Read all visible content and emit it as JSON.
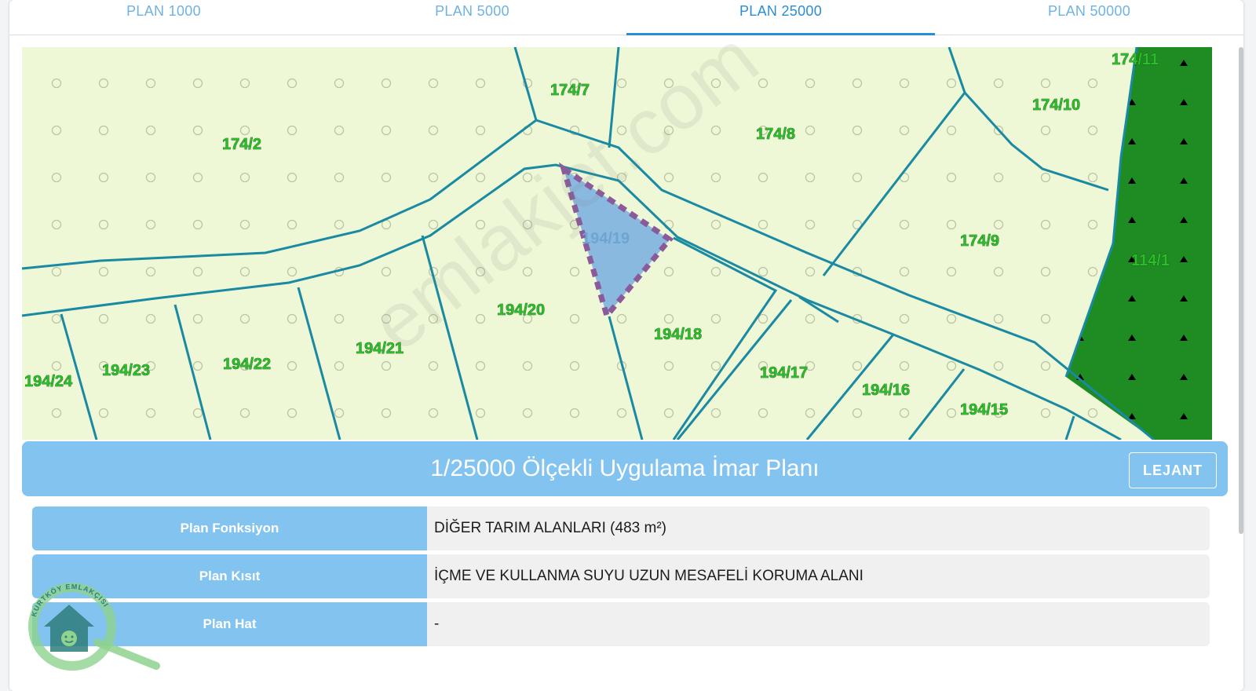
{
  "tabs": [
    {
      "label": "PLAN 1000",
      "active": false
    },
    {
      "label": "PLAN 5000",
      "active": false
    },
    {
      "label": "PLAN 25000",
      "active": true
    },
    {
      "label": "PLAN 50000",
      "active": false
    }
  ],
  "map": {
    "parcels": {
      "p174_2": "174/2",
      "p174_7": "174/7",
      "p174_8": "174/8",
      "p174_9": "174/9",
      "p174_10": "174/10",
      "p174_11": "174/11",
      "p114_1": "114/1",
      "p194_19": "194/19",
      "p194_20": "194/20",
      "p194_18": "194/18",
      "p194_17": "194/17",
      "p194_16": "194/16",
      "p194_15": "194/15",
      "p194_21": "194/21",
      "p194_22": "194/22",
      "p194_23": "194/23",
      "p194_24": "194/24"
    },
    "colors": {
      "agri": "#eef7d6",
      "forest": "#1e8b23",
      "boundary": "#1a8aa3",
      "selected_fill": "#8ab9e0",
      "selected_border": "#8a5a9a",
      "label": "#2bbd2a"
    }
  },
  "plan": {
    "title": "1/25000 Ölçekli Uygulama İmar Planı",
    "lejant_label": "LEJANT"
  },
  "info": {
    "function_label": "Plan Fonksiyon",
    "function_value": "DİĞER TARIM ALANLARI (483 m²)",
    "restriction_label": "Plan Kısıt",
    "restriction_value": "İÇME VE KULLANMA SUYU UZUN MESAFELİ KORUMA ALANI",
    "line_label": "Plan Hat",
    "line_value": "-"
  },
  "watermark": "emlakjet.com",
  "logo": {
    "text": "KURTKÖY EMLAKÇISI"
  }
}
